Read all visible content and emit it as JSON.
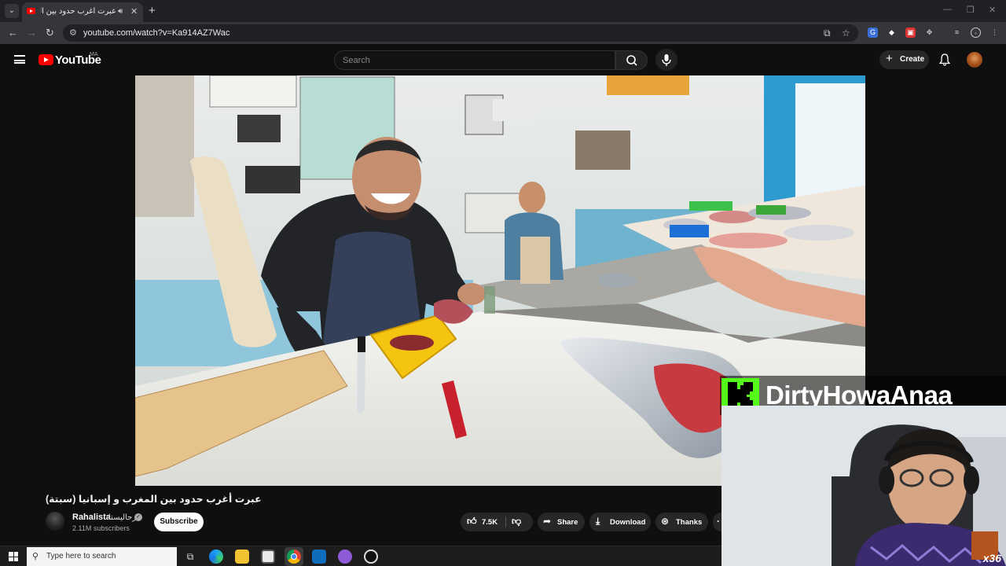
{
  "browser": {
    "tab": {
      "title": "عبرت أغرب حدود بين المغرب و",
      "audio_icon": "speaker-icon",
      "close_icon": "close-icon"
    },
    "new_tab_icon": "plus-icon",
    "url": "youtube.com/watch?v=Ka914AZ7Wac",
    "window_controls": [
      "minimize-icon",
      "restore-icon",
      "close-icon"
    ]
  },
  "youtube": {
    "logo_text": "YouTube",
    "country": "MA",
    "search_placeholder": "Search",
    "create_label": "Create"
  },
  "video": {
    "title": "عبرت أغرب حدود بين المغرب و إسبانيا (سبتة)",
    "channel": {
      "name": "Rahalista",
      "name_ar": "رحاليستا",
      "subscribers": "2.11M subscribers"
    },
    "subscribe_label": "Subscribe",
    "actions": {
      "likes": "7.5K",
      "share": "Share",
      "download": "Download",
      "thanks": "Thanks"
    }
  },
  "stream_overlay": {
    "streamer": "DirtyHowaAnaa",
    "logo_letter": "K",
    "brand_color": "#53fc18",
    "sticker_text": "x36"
  },
  "taskbar": {
    "search_placeholder": "Type here to search",
    "apps": [
      "task-view-icon",
      "edge-icon",
      "file-explorer-icon",
      "store-icon",
      "chrome-icon",
      "outlook-icon",
      "app-icon",
      "obs-icon"
    ]
  }
}
